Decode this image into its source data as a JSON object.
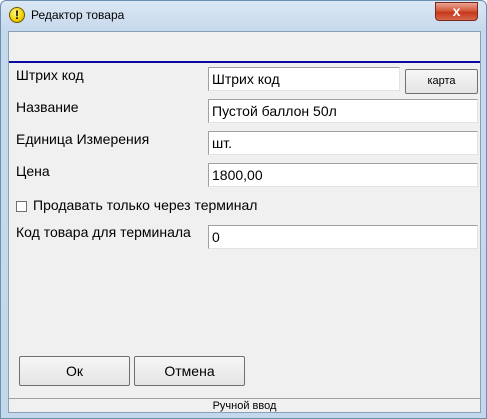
{
  "window": {
    "title": "Редактор товара",
    "close_glyph": "x",
    "icon": "warning-icon"
  },
  "form": {
    "barcode": {
      "label": "Штрих код",
      "value": "Штрих код",
      "card_button": "карта"
    },
    "name": {
      "label": "Название",
      "value": "Пустой баллон 50л"
    },
    "unit": {
      "label": "Единица Измерения",
      "value": "шт."
    },
    "price": {
      "label": "Цена",
      "value": "1800,00"
    },
    "terminal_only": {
      "label": "Продавать только через терминал",
      "checked": false
    },
    "terminal_code": {
      "label": "Код товара для терминала",
      "value": "0"
    }
  },
  "buttons": {
    "ok": "Ок",
    "cancel": "Отмена"
  },
  "status": {
    "text": "Ручной ввод"
  },
  "colors": {
    "accent_rule": "#0a0aa0",
    "title_bar": "#c4d7eb",
    "close_button": "#c5381c"
  }
}
